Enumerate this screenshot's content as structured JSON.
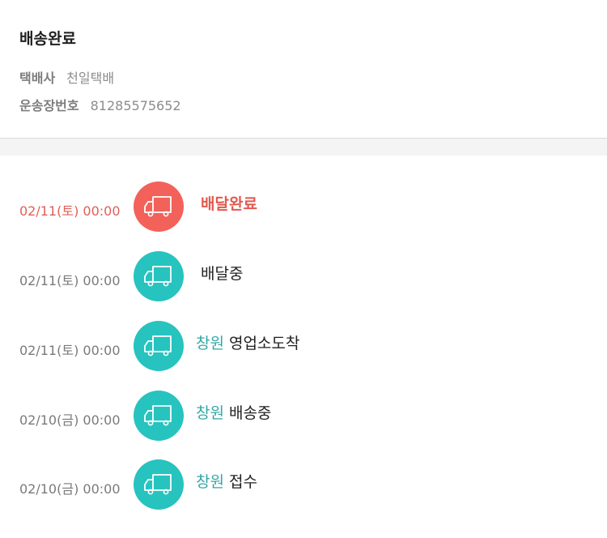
{
  "header": {
    "status": "배송완료",
    "courier_label": "택배사",
    "courier_value": "천일택배",
    "tracking_label": "운송장번호",
    "tracking_value": "81285575652"
  },
  "colors": {
    "active": "#f2625a",
    "step": "#27c3bf",
    "location_text": "#32a7a5"
  },
  "timeline": [
    {
      "time": "02/11(토) 00:00",
      "location": "",
      "status": "배달완료",
      "icon": "truck-icon",
      "active": true
    },
    {
      "time": "02/11(토) 00:00",
      "location": "",
      "status": "배달중",
      "icon": "truck-icon",
      "active": false
    },
    {
      "time": "02/11(토) 00:00",
      "location": "창원",
      "status": "영업소도착",
      "icon": "truck-icon",
      "active": false
    },
    {
      "time": "02/10(금) 00:00",
      "location": "창원",
      "status": "배송중",
      "icon": "truck-icon",
      "active": false
    },
    {
      "time": "02/10(금) 00:00",
      "location": "창원",
      "status": "접수",
      "icon": "truck-icon",
      "active": false
    }
  ]
}
